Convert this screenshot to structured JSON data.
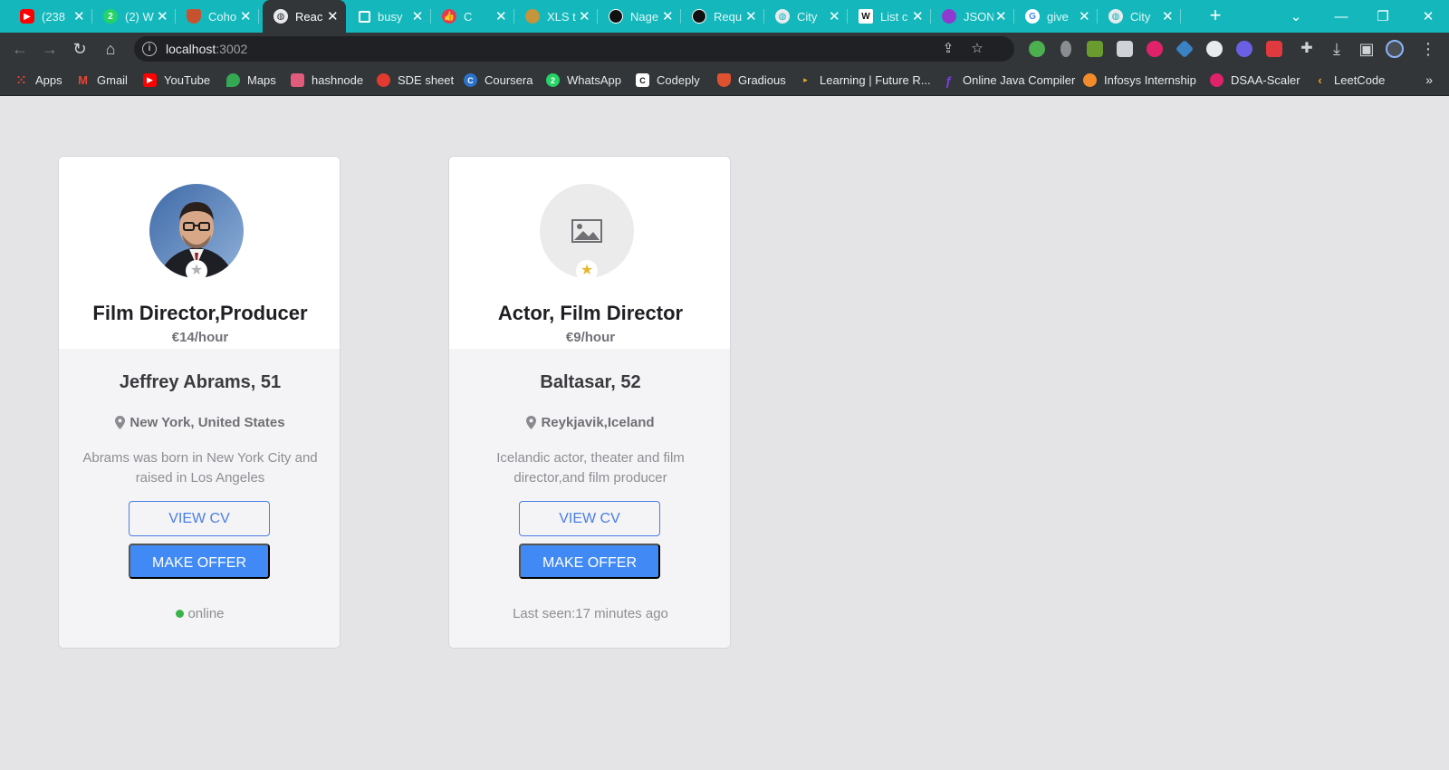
{
  "colors": {
    "tab_strip": "#14b8bc",
    "toolbar": "#323639",
    "page_bg": "#e4e4e6",
    "primary_button": "#4189f5",
    "outline_button": "#4a7ee6",
    "online_dot": "#3bb34a",
    "featured_star": "#e8b630",
    "plain_star": "#b0b0b4"
  },
  "tabs": [
    {
      "label": "(238",
      "icon": "youtube-icon",
      "color": "#ff0000"
    },
    {
      "label": "(2) W",
      "icon": "whatsapp-icon",
      "color": "#25d366"
    },
    {
      "label": "Coho",
      "icon": "shield-icon",
      "color": "#c8522f"
    },
    {
      "label": "Reac",
      "icon": "globe-icon",
      "color": "#ffffff",
      "active": true
    },
    {
      "label": "busy",
      "icon": "square-icon",
      "color": "#ffffff"
    },
    {
      "label": "C",
      "icon": "thumbs-up-icon",
      "color": "#e53950"
    },
    {
      "label": "XLS t",
      "icon": "coins-icon",
      "color": "#c4953c"
    },
    {
      "label": "Nage",
      "icon": "github-icon",
      "color": "#111111"
    },
    {
      "label": "Requ",
      "icon": "github-icon",
      "color": "#111111"
    },
    {
      "label": "City",
      "icon": "globe-icon",
      "color": "#ffffff"
    },
    {
      "label": "List c",
      "icon": "wikipedia-icon",
      "color": "#ffffff"
    },
    {
      "label": "JSON",
      "icon": "json-icon",
      "color": "#8e3ad0"
    },
    {
      "label": "give",
      "icon": "google-icon",
      "color": "#ffffff"
    },
    {
      "label": "City",
      "icon": "globe-icon",
      "color": "#ffffff"
    }
  ],
  "address": {
    "host": "localhost",
    "port": ":3002"
  },
  "bookmarks": [
    {
      "label": "Apps",
      "icon": "apps-grid-icon",
      "color": "#ea4335"
    },
    {
      "label": "Gmail",
      "icon": "gmail-icon",
      "color": "#ea4335"
    },
    {
      "label": "YouTube",
      "icon": "youtube-icon",
      "color": "#ff0000"
    },
    {
      "label": "Maps",
      "icon": "maps-pin-icon",
      "color": "#34a853"
    },
    {
      "label": "hashnode",
      "icon": "hashnode-icon",
      "color": "#e05c7a"
    },
    {
      "label": "SDE sheet",
      "icon": "sde-sheet-icon",
      "color": "#e23a2e"
    },
    {
      "label": "Coursera",
      "icon": "coursera-icon",
      "color": "#2a73cc"
    },
    {
      "label": "WhatsApp",
      "icon": "whatsapp-icon",
      "color": "#25d366"
    },
    {
      "label": "Codeply",
      "icon": "codeply-icon",
      "color": "#111111"
    },
    {
      "label": "Gradious",
      "icon": "gradious-icon",
      "color": "#e0522f"
    },
    {
      "label": "Learning | Future R...",
      "icon": "play-icon",
      "color": "#f2b01e"
    },
    {
      "label": "Online Java Compiler",
      "icon": "java-compiler-icon",
      "color": "#7b3fe4"
    },
    {
      "label": "Infosys Internship",
      "icon": "infosys-icon",
      "color": "#f28c2b"
    },
    {
      "label": "DSAA-Scaler",
      "icon": "scaler-icon",
      "color": "#e0226b"
    },
    {
      "label": "LeetCode",
      "icon": "leetcode-icon",
      "color": "#f89f1b"
    }
  ],
  "profiles": [
    {
      "role": "Film Director,Producer",
      "rate": "€14/hour",
      "name": "Jeffrey Abrams, 51",
      "location": "New York, United States",
      "description": "Abrams was born in New York City and raised in Los Angeles",
      "view_cv": "VIEW CV",
      "make_offer": "MAKE OFFER",
      "status": "online",
      "has_photo": true,
      "featured": false
    },
    {
      "role": "Actor, Film Director",
      "rate": "€9/hour",
      "name": "Baltasar, 52",
      "location": "Reykjavik,Iceland",
      "description": "Icelandic actor, theater and film director,and film producer",
      "view_cv": "VIEW CV",
      "make_offer": "MAKE OFFER",
      "status": "Last seen:17 minutes ago",
      "has_photo": false,
      "featured": true
    }
  ]
}
